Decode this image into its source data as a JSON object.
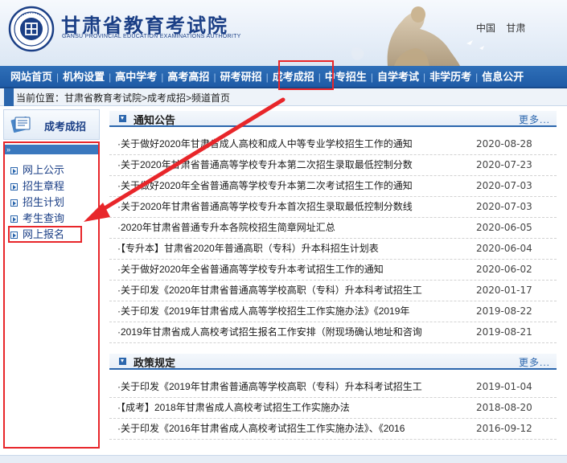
{
  "header": {
    "site_title": "甘肃省教育考试院",
    "site_subtitle": "GANSU PROVINCIAL EDUCATION EXAMINATIONS AUTHORITY",
    "region_links": [
      "中国",
      "甘肃"
    ],
    "logo_icon": "exam-authority-seal-icon",
    "statue_image": "mother-yellow-river-statue"
  },
  "nav": {
    "items": [
      {
        "label": "网站首页"
      },
      {
        "label": "机构设置"
      },
      {
        "label": "高中学考"
      },
      {
        "label": "高考高招"
      },
      {
        "label": "研考研招"
      },
      {
        "label": "成考成招"
      },
      {
        "label": "中专招生"
      },
      {
        "label": "自学考试"
      },
      {
        "label": "非学历考"
      },
      {
        "label": "信息公开"
      }
    ],
    "highlighted": "成考成招"
  },
  "breadcrumb": {
    "text": "当前位置：甘肃省教育考试院>成考成招>频道首页"
  },
  "sidebar": {
    "title": "成考成招",
    "bar_glyph": "»",
    "items": [
      {
        "label": "网上公示"
      },
      {
        "label": "招生章程"
      },
      {
        "label": "招生计划"
      },
      {
        "label": "考生查询"
      },
      {
        "label": "网上报名"
      }
    ],
    "highlighted": "网上报名"
  },
  "notices": {
    "title": "通知公告",
    "more": "更多...",
    "items": [
      {
        "title": "·关于做好2020年甘肃省成人高校和成人中等专业学校招生工作的通知",
        "date": "2020-08-28"
      },
      {
        "title": "·关于2020年甘肃省普通高等学校专升本第二次招生录取最低控制分数",
        "date": "2020-07-23"
      },
      {
        "title": "·关于做好2020年全省普通高等学校专升本第二次考试招生工作的通知",
        "date": "2020-07-03"
      },
      {
        "title": "·关于2020年甘肃省普通高等学校专升本首次招生录取最低控制分数线",
        "date": "2020-07-03"
      },
      {
        "title": "·2020年甘肃省普通专升本各院校招生简章网址汇总",
        "date": "2020-06-05"
      },
      {
        "title": "·【专升本】甘肃省2020年普通高职（专科）升本科招生计划表",
        "date": "2020-06-04"
      },
      {
        "title": "·关于做好2020年全省普通高等学校专升本考试招生工作的通知",
        "date": "2020-06-02"
      },
      {
        "title": "·关于印发《2020年甘肃省普通高等学校高职（专科）升本科考试招生工",
        "date": "2020-01-17"
      },
      {
        "title": "·关于印发《2019年甘肃省成人高等学校招生工作实施办法》《2019年",
        "date": "2019-08-22"
      },
      {
        "title": "·2019年甘肃省成人高校考试招生报名工作安排（附现场确认地址和咨询",
        "date": "2019-08-21"
      }
    ]
  },
  "policies": {
    "title": "政策规定",
    "more": "更多...",
    "items": [
      {
        "title": "·关于印发《2019年甘肃省普通高等学校高职（专科）升本科考试招生工",
        "date": "2019-01-04"
      },
      {
        "title": "·【成考】2018年甘肃省成人高校考试招生工作实施办法",
        "date": "2018-08-20"
      },
      {
        "title": "·关于印发《2016年甘肃省成人高校考试招生工作实施办法》、《2016",
        "date": "2016-09-12"
      }
    ]
  },
  "annotation": {
    "highlight_color": "#e8262a",
    "arrow_icon": "red-arrow-icon"
  }
}
